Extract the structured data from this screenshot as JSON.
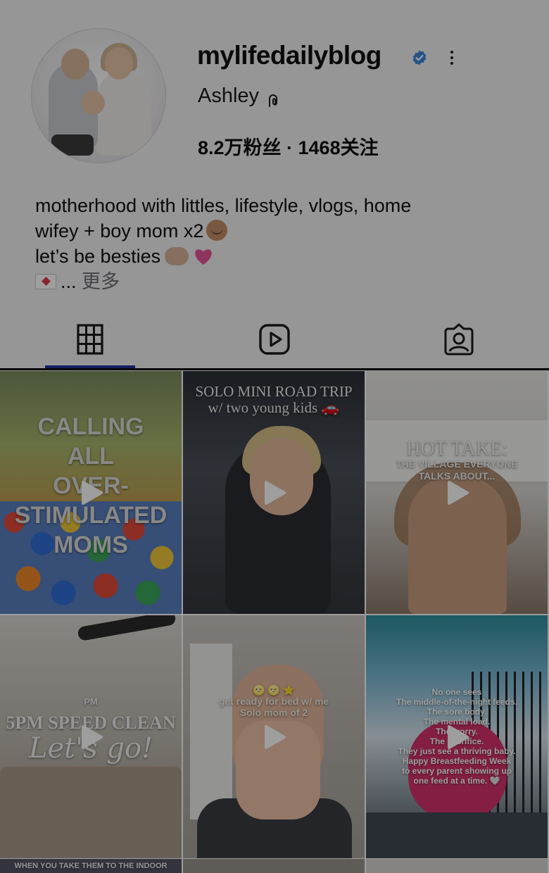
{
  "profile": {
    "username": "mylifedailyblog",
    "display_name": "Ashley",
    "stats": "8.2万粉丝 · 1468关注",
    "bio_lines": [
      "motherhood with littles, lifestyle, vlogs, home",
      "wifey + boy mom x2",
      "let’s be besties"
    ],
    "bio_more_prefix": "...",
    "bio_more_label": "更多",
    "verified_color": "#3a86d8",
    "icons": [
      "verified-badge-icon",
      "more-options-icon",
      "threads-icon"
    ]
  },
  "tabs": {
    "items": [
      "grid-icon",
      "reels-icon",
      "tagged-icon"
    ],
    "active": "grid",
    "accent_color": "#1d2f9e"
  },
  "posts": [
    {
      "lines": [
        "CALLING",
        "ALL",
        "OVER-",
        "STIMULATED",
        "MOMS"
      ]
    },
    {
      "lines": [
        "SOLO MINI ROAD TRIP",
        "w/ two young kids 🚗"
      ]
    },
    {
      "title": "HOT TAKE:",
      "sub": [
        "THE VILLAGE EVERYONE",
        "TALKS ABOUT..."
      ]
    },
    {
      "small": "PM",
      "title": "5PM SPEED CLEAN",
      "script": "Let's go!"
    },
    {
      "lines": [
        "🌝 🌝 ⭐",
        "get ready for bed w/ me",
        "Solo mom of 2"
      ]
    },
    {
      "lines": [
        "No one sees",
        "The middle-of-the-night feeds.",
        "The sore body.",
        "The mental load.",
        "The worry.",
        "The sacrifice.",
        "They just see a thriving baby.",
        "Happy Breastfeeding Week",
        "to every parent showing up",
        "one feed at a time. 🤍"
      ]
    },
    {
      "lines": [
        "WHEN YOU TAKE THEM TO THE INDOOR"
      ]
    }
  ]
}
